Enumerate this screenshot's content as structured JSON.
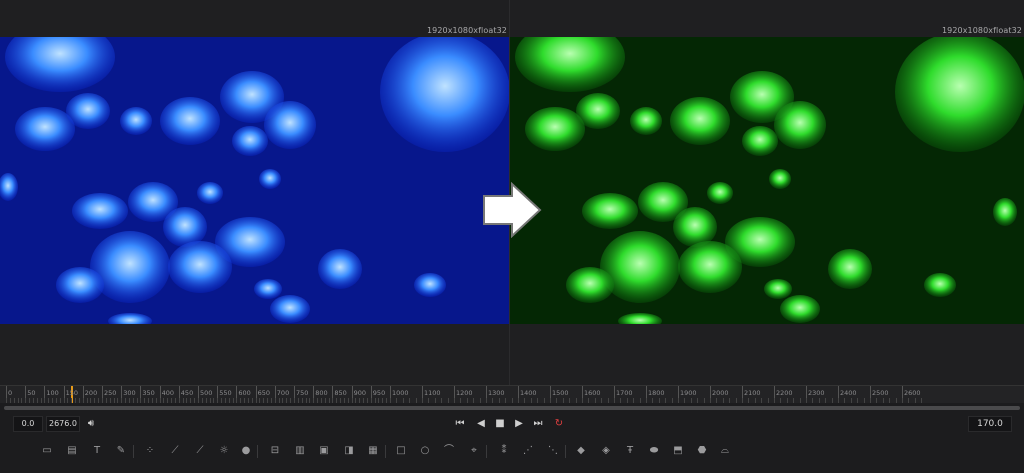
{
  "viewers": {
    "left": {
      "resolution": "1920x1080xfloat32",
      "tint": "#1a4cff"
    },
    "right": {
      "resolution": "1920x1080xfloat32",
      "tint": "#22e02a"
    }
  },
  "ruler": {
    "labels": [
      "0",
      "50",
      "100",
      "150",
      "200",
      "250",
      "300",
      "350",
      "400",
      "450",
      "500",
      "550",
      "600",
      "650",
      "700",
      "750",
      "800",
      "850",
      "900",
      "950",
      "1000",
      "1100",
      "1200",
      "1300",
      "1400",
      "1500",
      "1600",
      "1700",
      "1800",
      "1900",
      "2000",
      "2100",
      "2200",
      "2300",
      "2400",
      "2500",
      "2600"
    ]
  },
  "transport": {
    "start_value": "0.0",
    "end_value": "2676.0",
    "current_frame": "170.0",
    "loop_color": "#e04040"
  },
  "icons": {
    "playhead_color": "#e69a1a"
  }
}
